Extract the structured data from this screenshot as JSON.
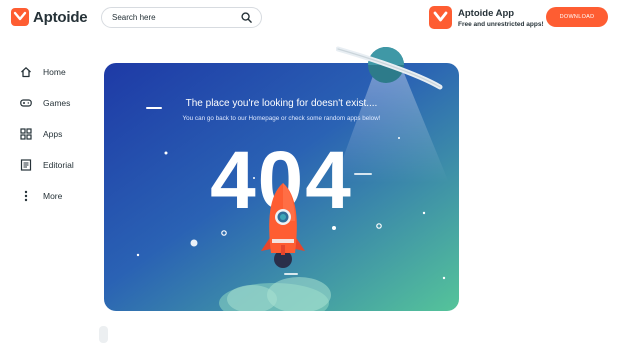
{
  "header": {
    "logo_text": "Aptoide",
    "search_placeholder": "Search here",
    "promo_title": "Aptoide App",
    "promo_subtitle": "Free and unrestricted apps!",
    "download_label": "DOWNLOAD"
  },
  "sidebar": {
    "items": [
      {
        "label": "Home",
        "icon": "home-icon"
      },
      {
        "label": "Games",
        "icon": "gamepad-icon"
      },
      {
        "label": "Apps",
        "icon": "apps-grid-icon"
      },
      {
        "label": "Editorial",
        "icon": "editorial-icon"
      },
      {
        "label": "More",
        "icon": "more-vertical-icon"
      }
    ]
  },
  "error": {
    "title": "The place you're looking for doesn't exist....",
    "subtitle": "You can go back to our Homepage or check some random apps below!",
    "code": "404"
  },
  "colors": {
    "brand": "#fe5d32",
    "card_gradient_start": "#1e40a8",
    "card_gradient_end": "#4cb89a"
  }
}
